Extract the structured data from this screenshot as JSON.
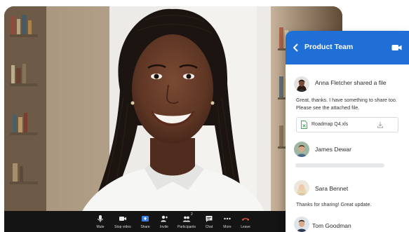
{
  "call": {
    "controls": [
      {
        "id": "mute",
        "label": "Mute",
        "icon": "mic-icon"
      },
      {
        "id": "stop-video",
        "label": "Stop video",
        "icon": "video-icon"
      },
      {
        "id": "share",
        "label": "Share",
        "icon": "share-screen-icon",
        "accent": "#3b7fe0"
      },
      {
        "id": "invite",
        "label": "Invite",
        "icon": "add-person-icon"
      },
      {
        "id": "participants",
        "label": "Participants",
        "icon": "participants-icon",
        "count": "2"
      },
      {
        "id": "chat",
        "label": "Chat",
        "icon": "chat-icon"
      },
      {
        "id": "more",
        "label": "More",
        "icon": "more-icon"
      },
      {
        "id": "leave",
        "label": "Leave",
        "icon": "hang-up-icon",
        "accent": "#e5533d"
      }
    ]
  },
  "chat": {
    "title": "Product Team",
    "header_color": "#1f6fd6",
    "messages": [
      {
        "name": "Anna Fletcher shared a file",
        "text": "Great, thanks. I have something to share too. Please see the attached file.",
        "attachment": "Roadmap Q4.xls"
      },
      {
        "name": "James Dewar",
        "text": ""
      },
      {
        "name": "Sara Bennet",
        "text": "Thanks for sharing! Great update."
      },
      {
        "name": "Tom Goodman",
        "text": ""
      }
    ]
  }
}
